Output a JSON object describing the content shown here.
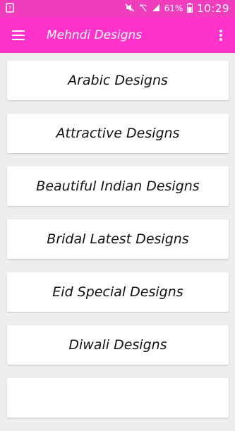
{
  "status_bar": {
    "battery_percent": "61%",
    "time": "10:29",
    "icons": [
      "notification-icon",
      "mute-icon",
      "wifi-off-icon",
      "signal-icon",
      "battery-icon"
    ]
  },
  "app_bar": {
    "title": "Mehndi Designs",
    "menu_icon": "hamburger-menu-icon",
    "more_icon": "overflow-menu-icon",
    "color": "#ff33cc"
  },
  "categories": [
    {
      "label": "Arabic Designs"
    },
    {
      "label": "Attractive Designs"
    },
    {
      "label": "Beautiful Indian Designs"
    },
    {
      "label": "Bridal Latest Designs"
    },
    {
      "label": "Eid Special Designs"
    },
    {
      "label": "Diwali Designs"
    },
    {
      "label": ""
    }
  ]
}
